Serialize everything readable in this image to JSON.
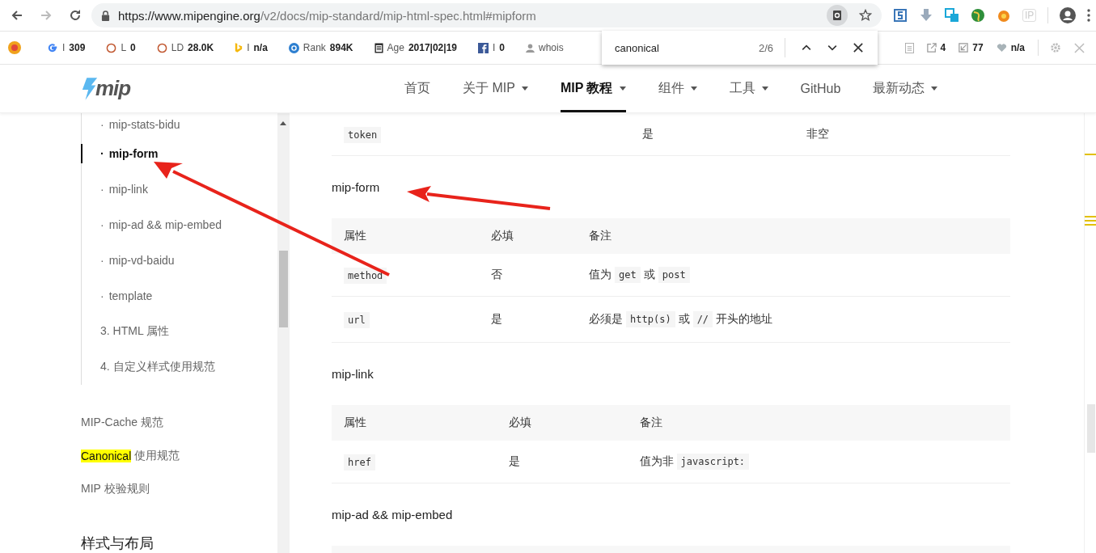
{
  "browser": {
    "url_host": "https://www.mipengine.org",
    "url_path": "/v2/docs/mip-standard/mip-html-spec.html#mipform",
    "extension_label": "IP"
  },
  "seo_bar": {
    "items": [
      {
        "kind": "google",
        "label": "I",
        "value": "309"
      },
      {
        "kind": "ring",
        "label": "L",
        "value": "0"
      },
      {
        "kind": "ring",
        "label": "LD",
        "value": "28.0K"
      },
      {
        "kind": "bing",
        "label": "I",
        "value": "n/a"
      },
      {
        "kind": "alexa",
        "label": "Rank",
        "value": "894K"
      },
      {
        "kind": "calendar",
        "label": "Age",
        "value": "2017|02|19"
      },
      {
        "kind": "facebook",
        "label": "I",
        "value": "0"
      },
      {
        "kind": "whois",
        "label": "whois"
      }
    ],
    "right_items": [
      {
        "kind": "doc"
      },
      {
        "kind": "out",
        "value": "4"
      },
      {
        "kind": "in",
        "value": "77"
      },
      {
        "kind": "heart",
        "value": "n/a"
      }
    ]
  },
  "find_bar": {
    "query": "canonical",
    "count": "2/6"
  },
  "site_nav": {
    "logo": "mip",
    "items": [
      {
        "label": "首页",
        "dropdown": false,
        "selected": false
      },
      {
        "label": "关于 MIP",
        "dropdown": true,
        "selected": false
      },
      {
        "label": "MIP 教程",
        "dropdown": true,
        "selected": true
      },
      {
        "label": "组件",
        "dropdown": true,
        "selected": false
      },
      {
        "label": "工具",
        "dropdown": true,
        "selected": false
      },
      {
        "label": "GitHub",
        "dropdown": false,
        "selected": false
      },
      {
        "label": "最新动态",
        "dropdown": true,
        "selected": false
      }
    ]
  },
  "sidebar": {
    "nested": [
      {
        "bullet": "·",
        "label": "mip-stats-bidu",
        "selected": false
      },
      {
        "bullet": "·",
        "label": "mip-form",
        "selected": true
      },
      {
        "bullet": "·",
        "label": "mip-link",
        "selected": false
      },
      {
        "bullet": "·",
        "label": "mip-ad && mip-embed",
        "selected": false
      },
      {
        "bullet": "·",
        "label": "mip-vd-baidu",
        "selected": false
      },
      {
        "bullet": "·",
        "label": "template",
        "selected": false
      },
      {
        "label": "3. HTML 属性",
        "selected": false
      },
      {
        "label": "4. 自定义样式使用规范",
        "selected": false
      }
    ],
    "items": [
      {
        "label": "MIP-Cache 规范"
      },
      {
        "highlight": "Canonical",
        "label": "使用规范"
      },
      {
        "label": "MIP 校验规则"
      }
    ],
    "section_title": "样式与布局"
  },
  "content": {
    "blocks": [
      {
        "kind": "table",
        "rows": [
          [
            [
              {
                "kind": "code",
                "text": "token"
              }
            ],
            [
              {
                "kind": "text",
                "text": "是"
              }
            ],
            [
              {
                "kind": "text",
                "text": "非空"
              }
            ]
          ]
        ]
      },
      {
        "kind": "heading",
        "text": "mip-form"
      },
      {
        "kind": "table",
        "columns": [
          "属性",
          "必填",
          "备注"
        ],
        "rows": [
          [
            [
              {
                "kind": "code",
                "text": "method"
              }
            ],
            [
              {
                "kind": "text",
                "text": "否"
              }
            ],
            [
              {
                "kind": "text",
                "text": "值为"
              },
              {
                "kind": "code",
                "text": "get"
              },
              {
                "kind": "text",
                "text": "或"
              },
              {
                "kind": "code",
                "text": "post"
              }
            ]
          ],
          [
            [
              {
                "kind": "code",
                "text": "url"
              }
            ],
            [
              {
                "kind": "text",
                "text": "是"
              }
            ],
            [
              {
                "kind": "text",
                "text": "必须是"
              },
              {
                "kind": "code",
                "text": "http(s)"
              },
              {
                "kind": "text",
                "text": "或"
              },
              {
                "kind": "code",
                "text": "//"
              },
              {
                "kind": "text",
                "text": "开头的地址"
              }
            ]
          ]
        ]
      },
      {
        "kind": "heading",
        "text": "mip-link"
      },
      {
        "kind": "table",
        "columns": [
          "属性",
          "必填",
          "备注"
        ],
        "rows": [
          [
            [
              {
                "kind": "code",
                "text": "href"
              }
            ],
            [
              {
                "kind": "text",
                "text": "是"
              }
            ],
            [
              {
                "kind": "text",
                "text": "值为非"
              },
              {
                "kind": "code",
                "text": "javascript:"
              }
            ]
          ]
        ]
      },
      {
        "kind": "heading",
        "text": "mip-ad && mip-embed"
      }
    ]
  }
}
